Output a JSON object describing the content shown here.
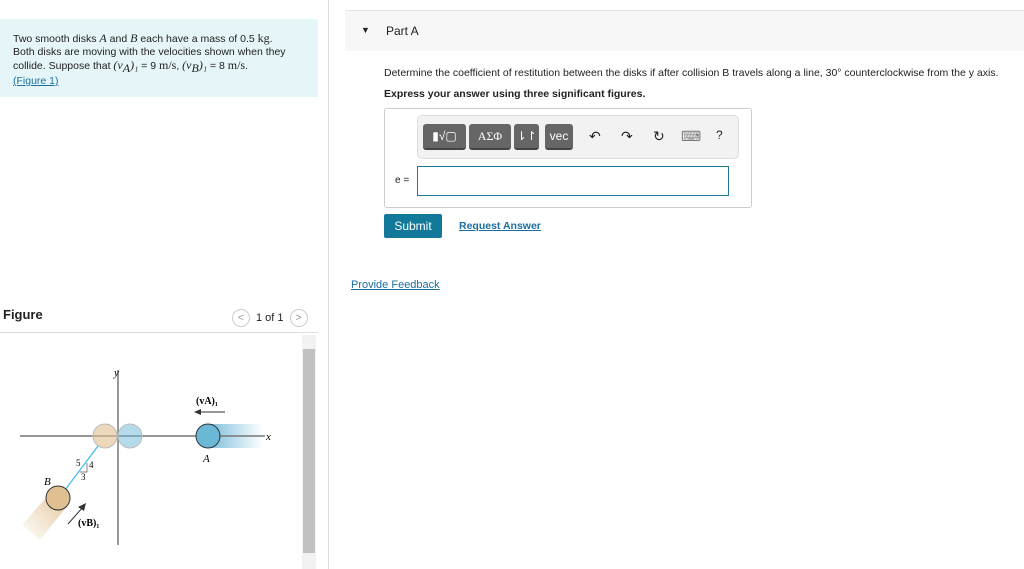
{
  "problem": {
    "t1": "Two smooth disks ",
    "A": "A",
    "t2": " and ",
    "B": "B",
    "t3": " each have a mass of 0.5 ",
    "kg": "kg",
    "t4": ".",
    "line2": "Both disks are moving with the velocities shown when they",
    "t5": "collide. Suppose that ",
    "vA": "(v",
    "vAsub": "A",
    "vA2": ")₁",
    "t6": " = 9 ",
    "ms": "m/s",
    "t7": ", ",
    "vB": "(v",
    "vBsub": "B",
    "vB2": ")₁",
    "t8": " = 8 ",
    "ms2": "m/s",
    "t9": ".",
    "figlink": "(Figure 1)"
  },
  "figure": {
    "label": "Figure",
    "pager": "1 of 1",
    "prev": "<",
    "next": ">",
    "y": "y",
    "x": "x",
    "A": "A",
    "B": "B",
    "vA": "(vA)₁",
    "vB": "(vB)₁",
    "n5": "5",
    "n4": "4",
    "n3": "3"
  },
  "part": {
    "title": "Part A",
    "question": "Determine the coefficient of restitution between the disks if after collision B travels along a line, 30° counterclockwise from the y axis.",
    "instruction": "Express your answer using three significant figures.",
    "var": "e =",
    "value": ""
  },
  "toolbar": {
    "templates": "▮√▢",
    "greek": "ΑΣΦ",
    "arrows": "⇂↾",
    "vec": "vec",
    "undo": "↶",
    "redo": "↷",
    "reset": "↻",
    "keyboard": "⌨",
    "help": "?"
  },
  "buttons": {
    "submit": "Submit",
    "request": "Request Answer",
    "feedback": "Provide Feedback"
  },
  "colors": {
    "accent": "#12799b",
    "diskA": "#6bb8d6",
    "diskB": "#e0c090"
  }
}
